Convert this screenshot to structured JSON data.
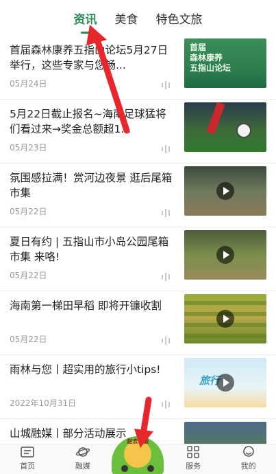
{
  "tabs": [
    {
      "label": "资讯",
      "active": true
    },
    {
      "label": "美食",
      "active": false
    },
    {
      "label": "特色文旅",
      "active": false
    }
  ],
  "news": [
    {
      "title": "首届森林康养五指山论坛5月27日举行，这些专家与您畅...",
      "date": "05月24日",
      "thumb_text": "首届\n森林康养\n五指山论坛",
      "has_play": false
    },
    {
      "title": "5月22日截止报名~海南足球猛将们看过来→奖金总额超1...",
      "date": "05月23日",
      "has_play": false
    },
    {
      "title": "氛围感拉满！赏河边夜景 逛后尾箱市集",
      "date": "05月22日",
      "has_play": true
    },
    {
      "title": "夏日有约 | 五指山市小岛公园尾箱市集 来咯!",
      "date": "05月22日",
      "has_play": true
    },
    {
      "title": "海南第一梯田早稻 即将开镰收割",
      "date": "05月22日",
      "has_play": true
    },
    {
      "title": "雨林与您丨超实用的旅行小tips!",
      "date": "2022年10月31日",
      "thumb_text": "旅行",
      "has_play": true
    },
    {
      "title": "山城融媒丨部分活动展示",
      "date": "",
      "has_play": false
    }
  ],
  "bottom_nav": [
    {
      "label": "首页",
      "icon": "newspaper-icon"
    },
    {
      "label": "融媒",
      "icon": "planet-icon"
    },
    {
      "label": "",
      "icon": "mascot-icon",
      "badge": "赵去吃饭"
    },
    {
      "label": "服务",
      "icon": "grid-icon"
    },
    {
      "label": "我的",
      "icon": "user-icon"
    }
  ],
  "colors": {
    "accent": "#2e8b57",
    "annotation": "#e8262b"
  }
}
